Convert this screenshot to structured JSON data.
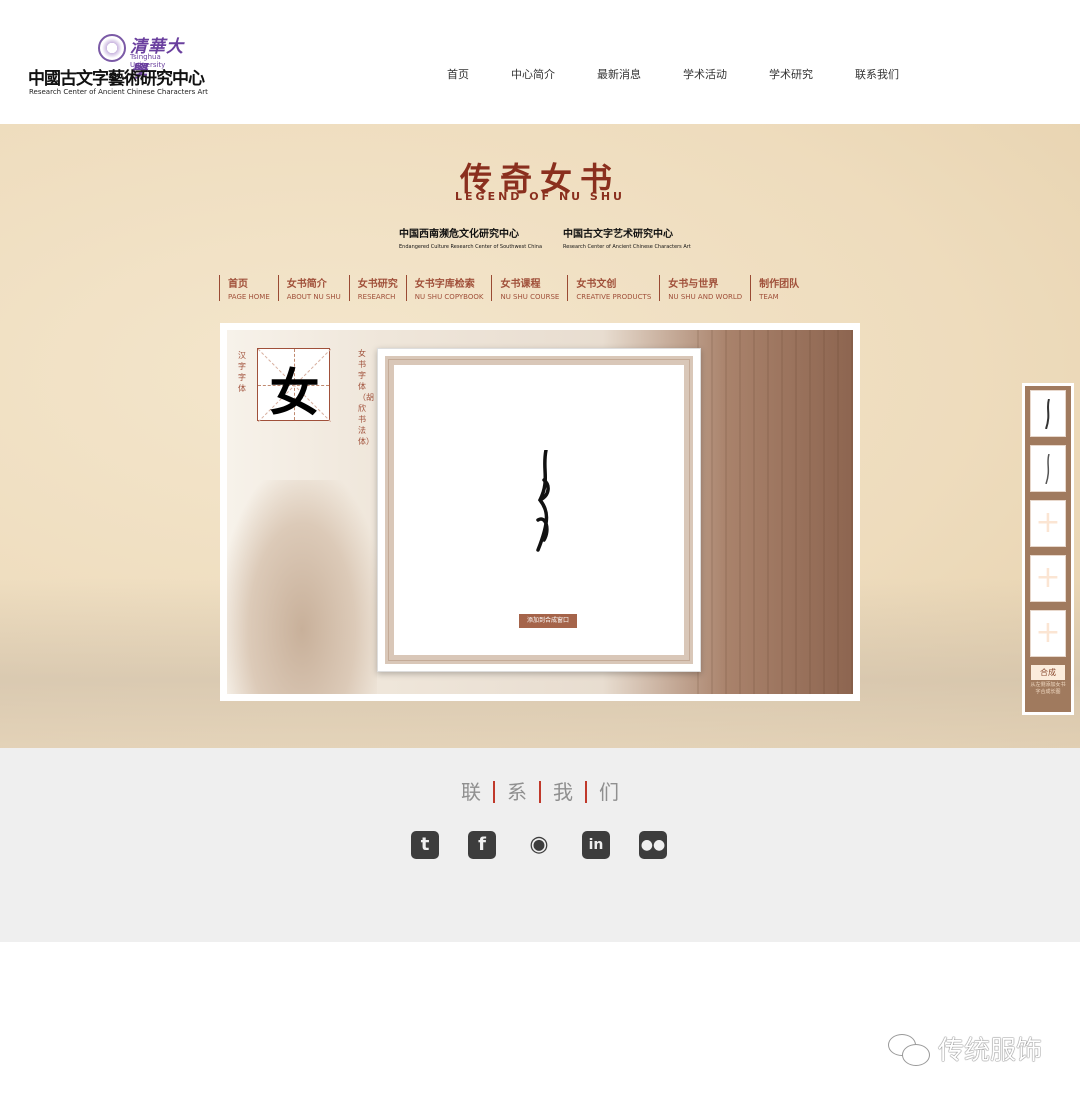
{
  "header": {
    "logo": {
      "university_cn": "清華大學",
      "university_en": "Tsinghua University",
      "center_cn": "中國古文字藝術研究中心",
      "center_en": "Research Center of Ancient Chinese Characters Art"
    },
    "nav": [
      "首页",
      "中心简介",
      "最新消息",
      "学术活动",
      "学术研究",
      "联系我们"
    ]
  },
  "banner": {
    "title": "传奇女书",
    "title_en": "LEGEND OF NU SHU",
    "orgs": [
      {
        "cn": "中国西南濒危文化研究中心",
        "en": "Endangered Culture Research Center of Southwest China"
      },
      {
        "cn": "中国古文字艺术研究中心",
        "en": "Research Center of Ancient Chinese Characters Art"
      }
    ],
    "subnav": [
      {
        "cn": "首页",
        "en": "PAGE HOME"
      },
      {
        "cn": "女书简介",
        "en": "ABOUT NU SHU"
      },
      {
        "cn": "女书研究",
        "en": "RESEARCH"
      },
      {
        "cn": "女书字库检索",
        "en": "NU SHU COPYBOOK"
      },
      {
        "cn": "女书课程",
        "en": "NU SHU COURSE"
      },
      {
        "cn": "女书文创",
        "en": "CREATIVE PRODUCTS"
      },
      {
        "cn": "女书与世界",
        "en": "NU SHU AND WORLD"
      },
      {
        "cn": "制作团队",
        "en": "TEAM"
      }
    ],
    "stage": {
      "han_label": "汉字字体",
      "han_char": "女",
      "nushu_label": "女书字体（胡欣书法体）",
      "add_button": "添加到合成窗口"
    },
    "compose": {
      "slots": [
        "filled",
        "filled",
        "empty",
        "empty",
        "empty"
      ],
      "empty_icon": "plus-icon",
      "button": "合成",
      "hint": "从左侧添加女书字合成长图"
    }
  },
  "footer": {
    "contact_chars": [
      "联",
      "系",
      "我",
      "们"
    ],
    "socials": [
      "twitter-icon",
      "facebook-icon",
      "weibo-icon",
      "linkedin-icon",
      "wechat-icon"
    ],
    "accent": "#c0392b"
  },
  "watermark": {
    "text": "传统服饰"
  }
}
